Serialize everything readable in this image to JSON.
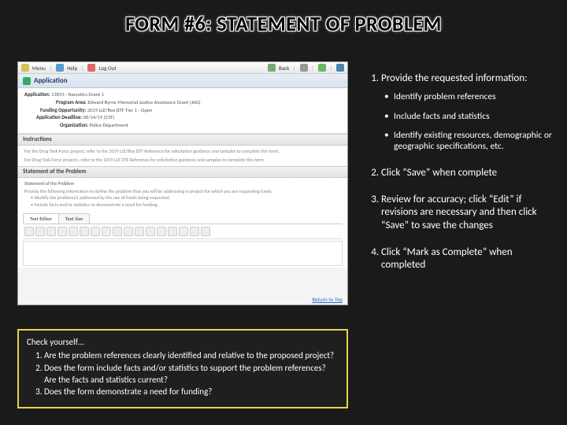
{
  "title": "FORM #6:  STATEMENT OF PROBLEM",
  "screenshot": {
    "toolbar": {
      "menu": "Menu",
      "help": "Help",
      "logout": "Log Out",
      "back": "Back"
    },
    "appHeader": "Application",
    "info": {
      "appLabel": "Application:",
      "appValue": "13693 - Narcotics Grant 1",
      "programLabel": "Program Area:",
      "programValue": "Edward Byrne Memorial Justice Assistance Grant (JAG)",
      "fundingLabel": "Funding Opportunity:",
      "fundingValue": "2019 LLE/Box DTF Tier 1 - Open",
      "deadlineLabel": "Application Deadline:",
      "deadlineValue": "06/14/19 (CST)",
      "orgLabel": "Organization:",
      "orgValue": "Police Department"
    },
    "instructionsHeader": "Instructions",
    "instructionsLine1": "For the Drug Task Force project, refer to the 2019 LLE/Box DTF Reference for solicitation guidance and samples to complete this form.",
    "instructionsLine2": "For Drug Task Force projects, refer to the 2019 LLE DTF Reference for solicitation guidance and samples to complete this form.",
    "statementHeader": "Statement of the Problem",
    "statementSub": "Statement of the Problem",
    "statementHelp1": "Provide the following information to define the problem that you will be addressing in project for which you are requesting funds.",
    "statementHelp2": "Identify the problem(s) addressed by the use of funds being requested.",
    "statementHelp3": "Include facts and/or statistics to demonstrate a need for funding.",
    "editor": {
      "tab1": "Text Editor",
      "tab2": "Text Size"
    },
    "returnTop": "Return to Top"
  },
  "checkYourself": {
    "lead": "Check yourself…",
    "items": [
      "Are the problem references clearly identified and relative to the proposed project?",
      "Does the form include facts and/or statistics to support the problem references?  Are the facts and statistics current?",
      "Does the form demonstrate a need for funding?"
    ]
  },
  "steps": {
    "s1": "Provide the requested information:",
    "s1_bullets": [
      "Identify problem references",
      "Include facts and statistics",
      "Identify existing resources, demographic or geographic specifications, etc."
    ],
    "s2": "Click “Save” when complete",
    "s3": "Review for accuracy; click “Edit” if revisions are necessary and then click “Save” to save the changes",
    "s4": "Click “Mark as Complete” when completed"
  }
}
